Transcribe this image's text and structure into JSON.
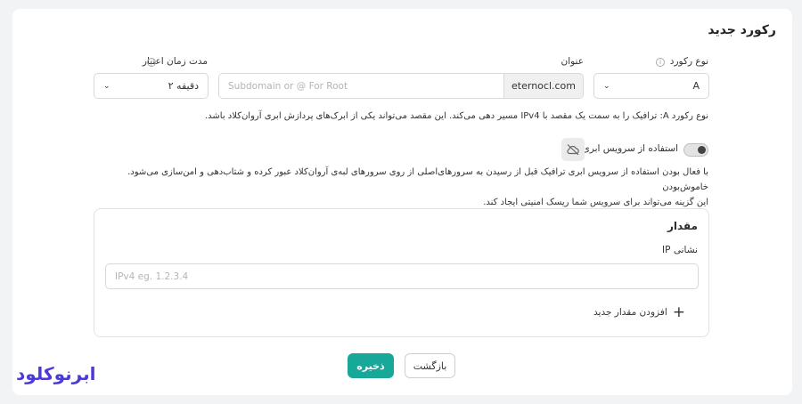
{
  "form": {
    "title": "رکورد جدید",
    "record_type": {
      "label": "نوع رکورد",
      "value": "A"
    },
    "name": {
      "label": "عنوان",
      "placeholder": "Subdomain or @ For Root",
      "suffix": "eternocl.com"
    },
    "ttl": {
      "label": "مدت زمان اعتبار",
      "value": "۲ دقیقه"
    },
    "type_description": "نوع رکورد A: ترافیک را به سمت یک مقصد با IPv4 مسیر دهی می‌کند. این مقصد می‌تواند یکی از ابرک‌های پردازش ابری آروان‌کلاد باشد.",
    "cloud": {
      "label": "استفاده از سرویس ابری",
      "enabled": true,
      "description_line1": "با فعال بودن استفاده از سرویس ابری ترافیک قبل از رسیدن به سرورهای‌اصلی از روی سرورهای لبه‌ی آروان‌کلاد عبور کرده و شتاب‌دهی و امن‌سازی می‌شود. خاموش‌بودن",
      "description_line2": "این گزینه می‌تواند برای سرویس شما ریسک امنیتی ایجاد کند."
    },
    "value_section": {
      "title": "مقدار",
      "ip_label": "نشانی IP",
      "ip_placeholder": "IPv4 eg. 1.2.3.4",
      "add_label": "افزودن مقدار جدید"
    },
    "buttons": {
      "save": "ذخیره",
      "back": "بازگشت"
    }
  },
  "brand": {
    "logo_text": "ابرنوکلود",
    "color": "#4b3bd6"
  },
  "colors": {
    "primary": "#17a89a"
  }
}
